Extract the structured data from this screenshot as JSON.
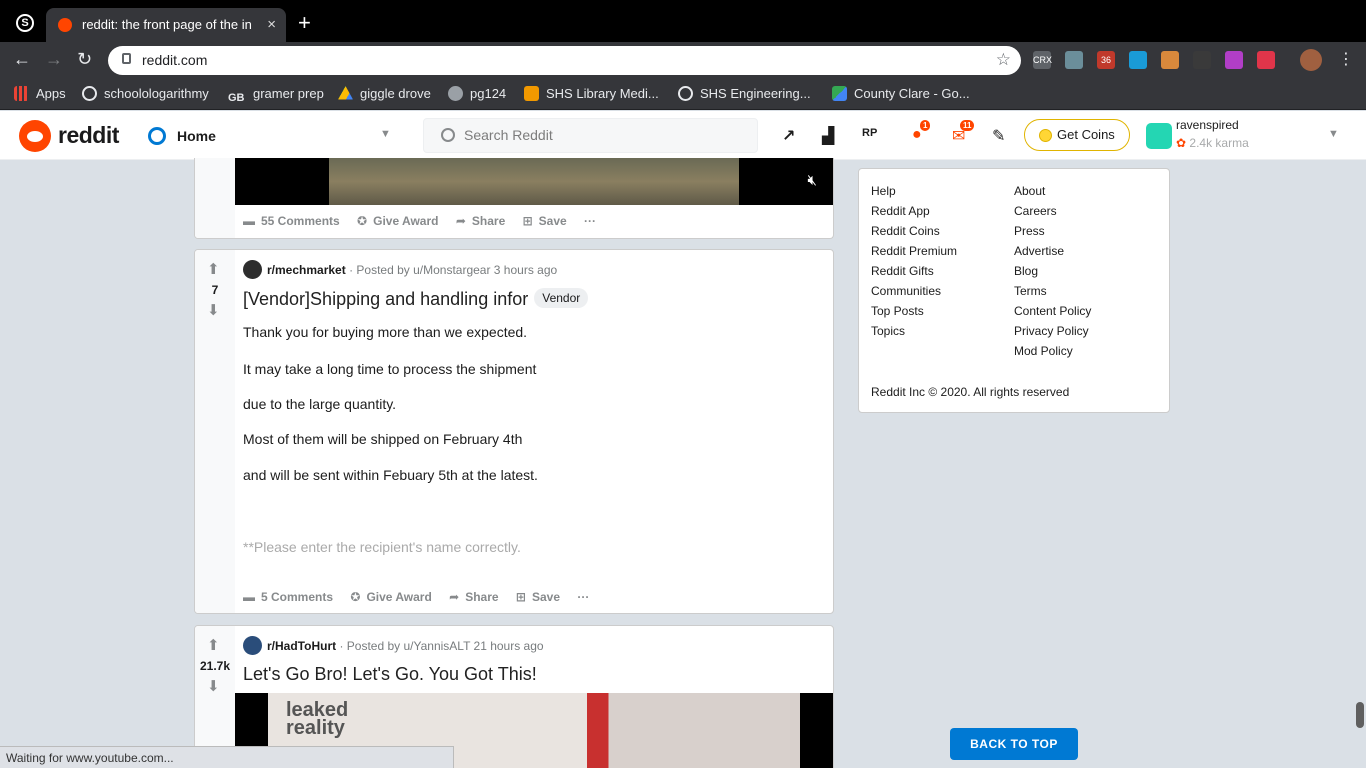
{
  "browser": {
    "tab_title": "reddit: the front page of the internet",
    "tab_close": "×",
    "new_tab": "+",
    "url": "reddit.com",
    "status": "Waiting for www.youtube.com...",
    "extensions": [
      {
        "name": "crx-icon",
        "label": "CRX",
        "color": "#5f6368"
      },
      {
        "name": "owl-icon",
        "label": "",
        "color": "#6b8e9a"
      },
      {
        "name": "abp-icon",
        "label": "36",
        "color": "#c0392b"
      },
      {
        "name": "checkmark-ext-icon",
        "label": "",
        "color": "#1a9bd7"
      },
      {
        "name": "box-ext-icon",
        "label": "",
        "color": "#d8893c"
      },
      {
        "name": "leaf-ext-icon",
        "label": "",
        "color": "#3a3a3a"
      },
      {
        "name": "color-ext-icon",
        "label": "",
        "color": "#b13ec7"
      },
      {
        "name": "pocket-ext-icon",
        "label": "",
        "color": "#e0354a"
      }
    ]
  },
  "bookmarks": [
    {
      "label": "Apps",
      "icon": "apps-grid-icon",
      "color": "#ea4335"
    },
    {
      "label": "schoolologarithmy",
      "icon": "schoology-icon",
      "color": "#35363a"
    },
    {
      "label": "gramer prep",
      "icon": "gb-icon",
      "color": "#222222"
    },
    {
      "label": "giggle drove",
      "icon": "drive-icon",
      "color": "#fbbc04"
    },
    {
      "label": "pg124",
      "icon": "globe-icon",
      "color": "#9aa0a6"
    },
    {
      "label": "SHS Library Medi...",
      "icon": "library-icon",
      "color": "#f29900"
    },
    {
      "label": "SHS Engineering...",
      "icon": "schoology-icon",
      "color": "#35363a"
    },
    {
      "label": "County Clare - Go...",
      "icon": "maps-icon",
      "color": "#34a853"
    }
  ],
  "header": {
    "logo_text": "reddit",
    "home_label": "Home",
    "search_placeholder": "Search Reddit",
    "chat_badge": "1",
    "mail_badge": "11",
    "coins_label": "Get Coins",
    "username": "ravenspired",
    "karma": "2.4k karma"
  },
  "posts": [
    {
      "comments": "55 Comments",
      "award": "Give Award",
      "share": "Share",
      "save": "Save",
      "more": "···"
    },
    {
      "score": "7",
      "subreddit": "r/mechmarket",
      "posted_by": "· Posted by u/Monstargear 3 hours ago",
      "title": "[Vendor]Shipping and handling infor",
      "flair": "Vendor",
      "body": [
        "Thank you for buying more than we expected.",
        "It may take a long time to process the shipment",
        "due to the large quantity.",
        "Most of them will be shipped on February 4th",
        "and will be sent within Febuary 5th at the latest.",
        "**Please enter the recipient's name correctly."
      ],
      "comments": "5 Comments",
      "award": "Give Award",
      "share": "Share",
      "save": "Save",
      "more": "···",
      "icon_color": "#2d2d2d"
    },
    {
      "score": "21.7k",
      "subreddit": "r/HadToHurt",
      "posted_by": "· Posted by u/YannisALT 21 hours ago",
      "title": "Let's Go Bro! Let's Go. You Got This!",
      "watermark": "leaked reality",
      "icon_color": "#2a4d7a"
    }
  ],
  "sidebar": {
    "col1": [
      "Help",
      "Reddit App",
      "Reddit Coins",
      "Reddit Premium",
      "Reddit Gifts",
      "Communities",
      "Top Posts",
      "Topics"
    ],
    "col2": [
      "About",
      "Careers",
      "Press",
      "Advertise",
      "Blog",
      "Terms",
      "Content Policy",
      "Privacy Policy",
      "Mod Policy"
    ],
    "copyright": "Reddit Inc © 2020. All rights reserved"
  },
  "back_to_top": "BACK TO TOP",
  "colors": {
    "accent": "#0079d3",
    "reddit_orange": "#ff4500"
  }
}
